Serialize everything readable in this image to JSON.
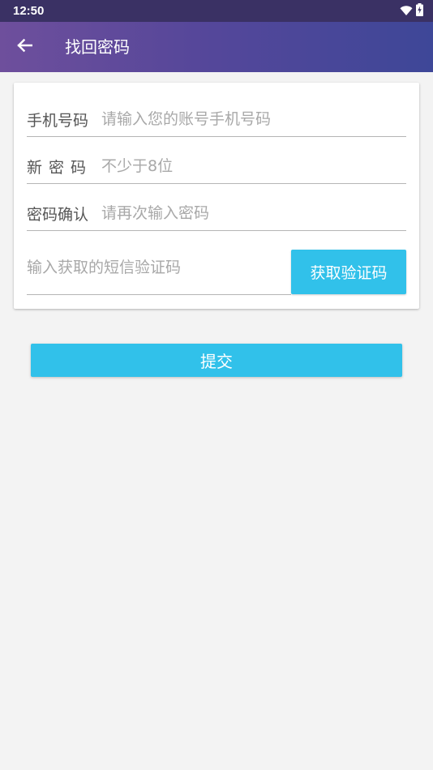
{
  "status_bar": {
    "time": "12:50",
    "icons": [
      "wifi-icon",
      "battery-charging-icon"
    ]
  },
  "app_bar": {
    "back_icon": "arrow-left-icon",
    "title": "找回密码",
    "gradient": [
      "#6e4f9c",
      "#3e4798"
    ]
  },
  "form": {
    "phone": {
      "label": "手机号码",
      "value": "",
      "placeholder": "请输入您的账号手机号码"
    },
    "new_password": {
      "label": "新密码",
      "value": "",
      "placeholder": "不少于8位"
    },
    "confirm_password": {
      "label": "密码确认",
      "value": "",
      "placeholder": "请再次输入密码"
    },
    "sms_code": {
      "value": "",
      "placeholder": "输入获取的短信验证码",
      "button_label": "获取验证码"
    }
  },
  "submit_label": "提交",
  "colors": {
    "accent": "#31c1ea",
    "background": "#f3f3f3"
  }
}
